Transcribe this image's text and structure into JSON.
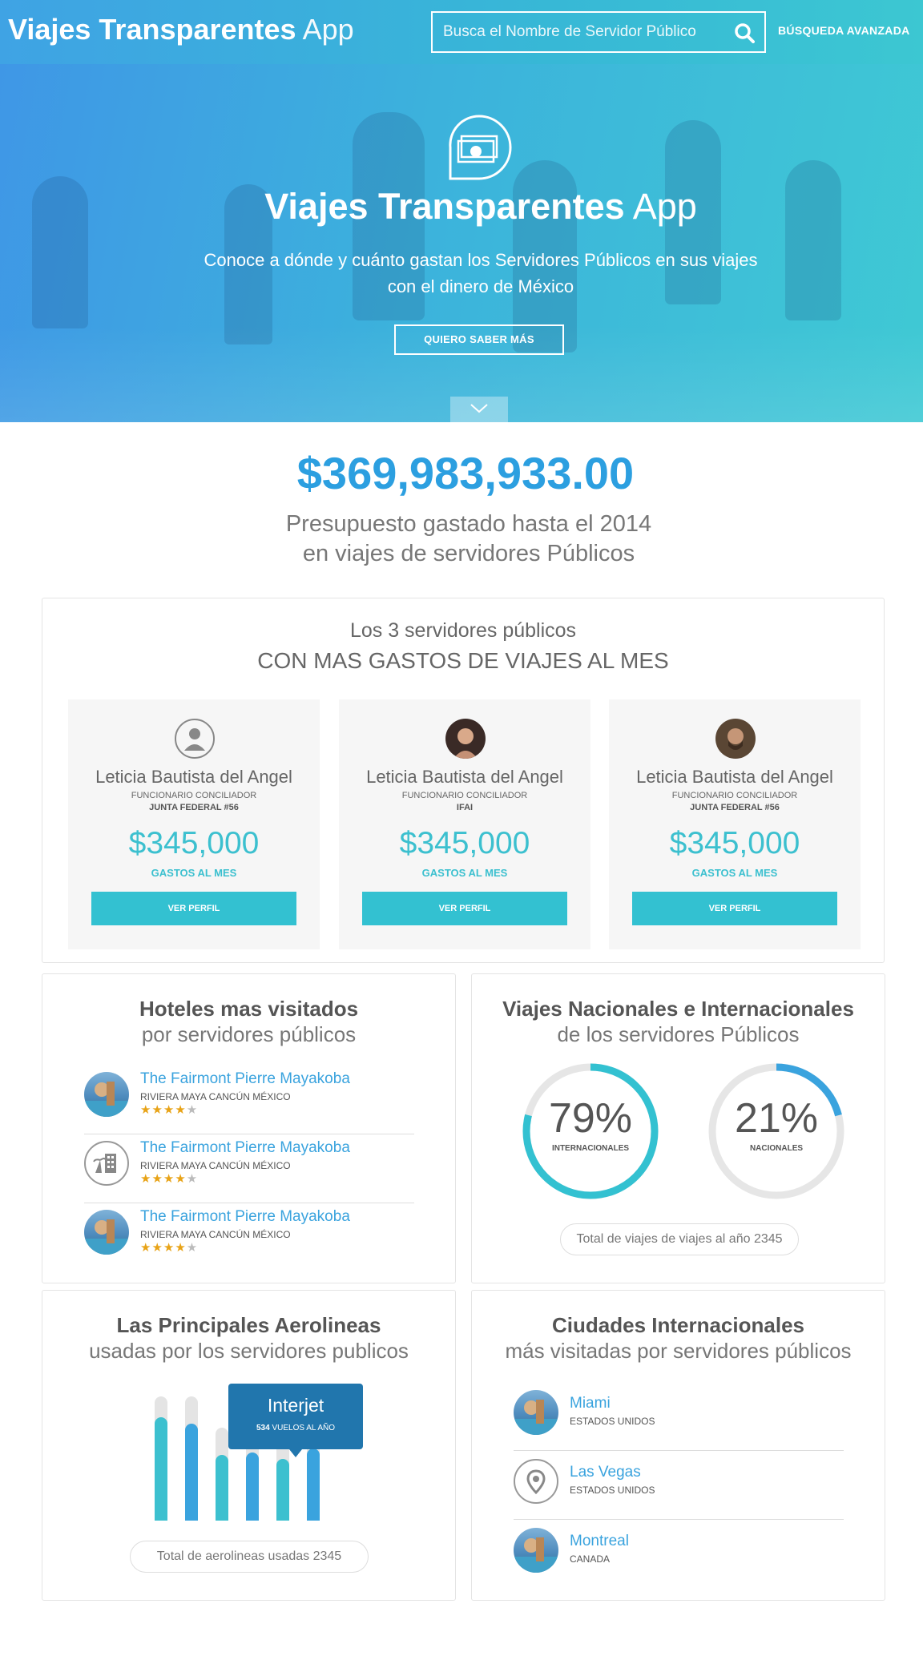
{
  "header": {
    "brand_bold": "Viajes Transparentes",
    "brand_light": "App",
    "search_placeholder": "Busca el  Nombre de Servidor Público",
    "advanced_search": "BÚSQUEDA AVANZADA"
  },
  "hero": {
    "title_bold": "Viajes Transparentes",
    "title_light": "App",
    "subtitle_line1": "Conoce a dónde y cuánto gastan los Servidores Públicos en sus viajes",
    "subtitle_line2": "con el dinero de México",
    "cta": "QUIERO SABER MÁS"
  },
  "budget": {
    "amount": "$369,983,933.00",
    "line1": "Presupuesto gastado hasta el 2014",
    "line2": "en viajes de servidores Públicos"
  },
  "top3": {
    "title1": "Los 3 servidores públicos",
    "title2": "CON MAS GASTOS DE VIAJES AL MES",
    "cards": [
      {
        "name": "Leticia Bautista del Angel",
        "role": "FUNCIONARIO CONCILIADOR",
        "org": "JUNTA FEDERAL #56",
        "amount": "$345,000",
        "amount_label": "GASTOS AL MES",
        "button": "VER PERFIL"
      },
      {
        "name": "Leticia Bautista del Angel",
        "role": "FUNCIONARIO CONCILIADOR",
        "org": "IFAI",
        "amount": "$345,000",
        "amount_label": "GASTOS AL MES",
        "button": "VER PERFIL"
      },
      {
        "name": "Leticia Bautista del Angel",
        "role": "FUNCIONARIO CONCILIADOR",
        "org": "JUNTA FEDERAL #56",
        "amount": "$345,000",
        "amount_label": "GASTOS AL MES",
        "button": "VER PERFIL"
      }
    ]
  },
  "hotels": {
    "title1": "Hoteles mas visitados",
    "title2": "por servidores públicos",
    "items": [
      {
        "name": "The Fairmont Pierre Mayakoba",
        "location": "RIVIERA MAYA CANCÚN MÉXICO",
        "stars": 4
      },
      {
        "name": "The Fairmont Pierre Mayakoba",
        "location": "RIVIERA MAYA CANCÚN MÉXICO",
        "stars": 4
      },
      {
        "name": "The Fairmont Pierre Mayakoba",
        "location": "RIVIERA MAYA CANCÚN MÉXICO",
        "stars": 4
      }
    ]
  },
  "trips": {
    "title1": "Viajes Nacionales e Internacionales",
    "title2": "de los servidores Públicos",
    "international_value": "79%",
    "international_fraction": 0.79,
    "international_label": "INTERNACIONALES",
    "national_value": "21%",
    "national_fraction": 0.21,
    "national_label": "NACIONALES",
    "total": "Total de viajes de viajes al año 2345"
  },
  "airlines": {
    "title1": "Las Principales Aerolineas",
    "title2": "usadas por los servidores publicos",
    "tooltip_name": "Interjet",
    "tooltip_value_bold": "534",
    "tooltip_value_rest": "VUELOS AL AÑO",
    "total": "Total de aerolineas usadas 2345"
  },
  "cities": {
    "title1": "Ciudades Internacionales",
    "title2": "más visitadas por servidores públicos",
    "items": [
      {
        "name": "Miami",
        "country": "ESTADOS UNIDOS"
      },
      {
        "name": "Las Vegas",
        "country": "ESTADOS UNIDOS"
      },
      {
        "name": "Montreal",
        "country": "CANADA"
      }
    ]
  },
  "colors": {
    "accent_blue": "#2c9fe0",
    "accent_teal": "#33c1d1",
    "tooltip": "#2176ad",
    "star": "#e8a317"
  },
  "chart_data": {
    "type": "bar",
    "categories": [],
    "values": [
      0.83,
      0.78,
      0.53,
      0.55,
      0.5,
      0.58
    ],
    "title": "Las Principales Aerolineas",
    "ylim": [
      0,
      1
    ]
  }
}
